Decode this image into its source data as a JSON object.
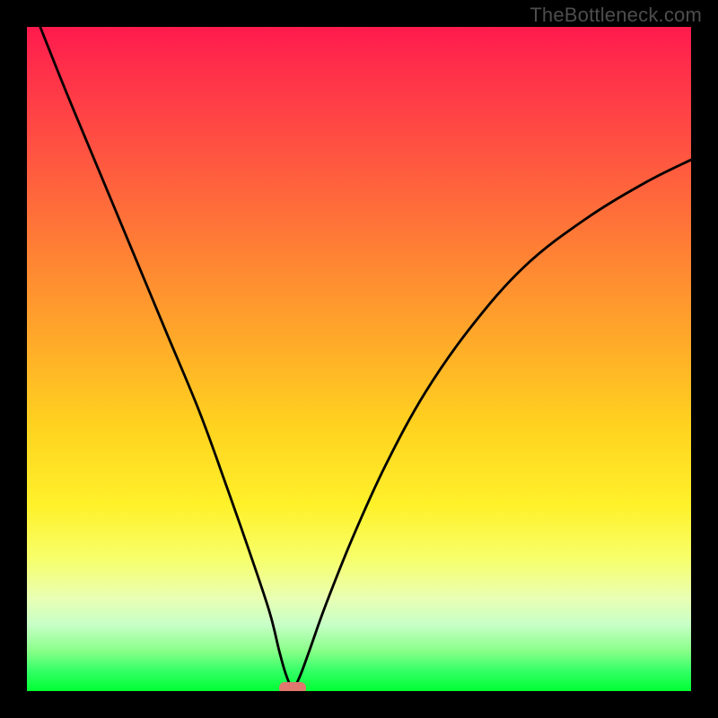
{
  "watermark": "TheBottleneck.com",
  "colors": {
    "frame_bg": "#000000",
    "marker": "#e0786f",
    "watermark_text": "#4d4d4d",
    "curve_stroke": "#000000"
  },
  "chart_data": {
    "type": "line",
    "title": "",
    "xlabel": "",
    "ylabel": "",
    "xlim": [
      0,
      100
    ],
    "ylim": [
      0,
      100
    ],
    "annotations": {
      "marker_x": 40,
      "marker_y": 0.5,
      "marker_width": 4,
      "marker_height": 1.7
    },
    "curve_points": [
      {
        "x": 2.0,
        "y": 100.0
      },
      {
        "x": 6.0,
        "y": 90.0
      },
      {
        "x": 11.0,
        "y": 78.0
      },
      {
        "x": 16.0,
        "y": 66.0
      },
      {
        "x": 21.0,
        "y": 54.0
      },
      {
        "x": 26.0,
        "y": 42.0
      },
      {
        "x": 30.0,
        "y": 31.0
      },
      {
        "x": 33.5,
        "y": 21.0
      },
      {
        "x": 36.5,
        "y": 12.0
      },
      {
        "x": 38.0,
        "y": 6.0
      },
      {
        "x": 39.0,
        "y": 2.5
      },
      {
        "x": 40.0,
        "y": 0.5
      },
      {
        "x": 41.0,
        "y": 2.0
      },
      {
        "x": 42.5,
        "y": 6.0
      },
      {
        "x": 45.0,
        "y": 13.0
      },
      {
        "x": 49.0,
        "y": 23.0
      },
      {
        "x": 54.0,
        "y": 34.0
      },
      {
        "x": 60.0,
        "y": 45.0
      },
      {
        "x": 67.0,
        "y": 55.0
      },
      {
        "x": 75.0,
        "y": 64.0
      },
      {
        "x": 84.0,
        "y": 71.0
      },
      {
        "x": 93.0,
        "y": 76.5
      },
      {
        "x": 100.0,
        "y": 80.0
      }
    ]
  }
}
